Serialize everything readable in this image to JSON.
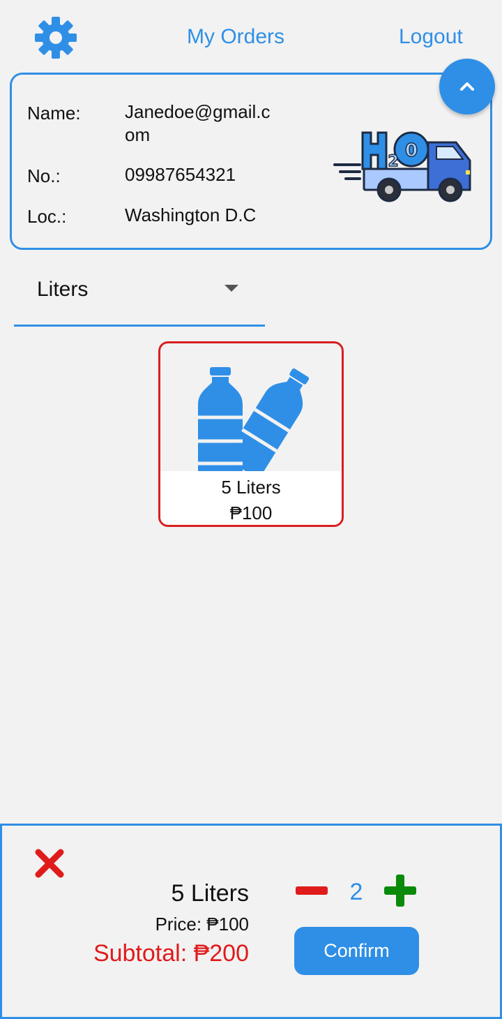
{
  "header": {
    "settings_icon": "gear-icon",
    "my_orders": "My Orders",
    "logout": "Logout"
  },
  "profile": {
    "name_label": "Name:",
    "name_value": "Janedoe@gmail.com",
    "number_label": "No.:",
    "number_value": "09987654321",
    "location_label": "Loc.:",
    "location_value": "Washington D.C",
    "logo_text": "H2O",
    "collapse_icon": "chevron-up-icon"
  },
  "filter": {
    "selected": "Liters"
  },
  "products": [
    {
      "name": "5 Liters",
      "price": "₱100",
      "image_icon": "water-bottles-icon"
    }
  ],
  "cart": {
    "remove_icon": "close-icon",
    "item_name": "5 Liters",
    "price_text": "Price: ₱100",
    "subtotal_text": "Subtotal: ₱200",
    "quantity": "2",
    "minus_icon": "minus-icon",
    "plus_icon": "plus-icon",
    "confirm_label": "Confirm"
  },
  "colors": {
    "accent": "#2f8fe6",
    "danger": "#e01b1b",
    "success": "#0a8a0a",
    "background": "#f2f2f2"
  }
}
